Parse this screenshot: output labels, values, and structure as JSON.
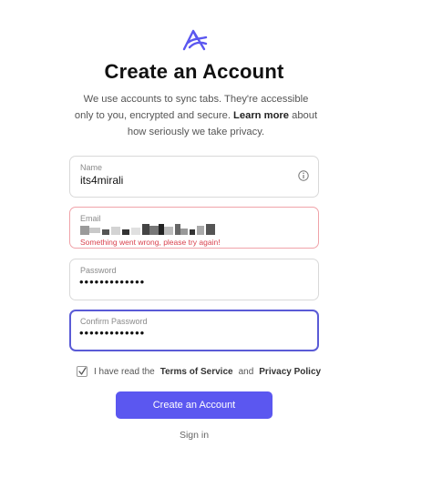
{
  "header": {
    "title": "Create an Account",
    "subtitle_pre": "We use accounts to sync tabs. They're accessible only to you, encrypted and secure. ",
    "learn_more": "Learn more",
    "subtitle_post": " about how seriously we take privacy."
  },
  "form": {
    "name": {
      "label": "Name",
      "value": "its4mirali",
      "icon": "info-icon"
    },
    "email": {
      "label": "Email",
      "error": "Something went wrong, please try again!"
    },
    "password": {
      "label": "Password",
      "value": "•••••••••••••"
    },
    "confirm_password": {
      "label": "Confirm Password",
      "value": "•••••••••••••"
    }
  },
  "terms": {
    "prefix": "I have read the",
    "terms_link": "Terms of Service",
    "and": "and",
    "privacy_link": "Privacy Policy",
    "checked": true
  },
  "actions": {
    "submit_label": "Create an Account",
    "signin_label": "Sign in"
  },
  "colors": {
    "accent": "#5b57f0",
    "error": "#d9434f",
    "edge": "#5a5bd6"
  }
}
